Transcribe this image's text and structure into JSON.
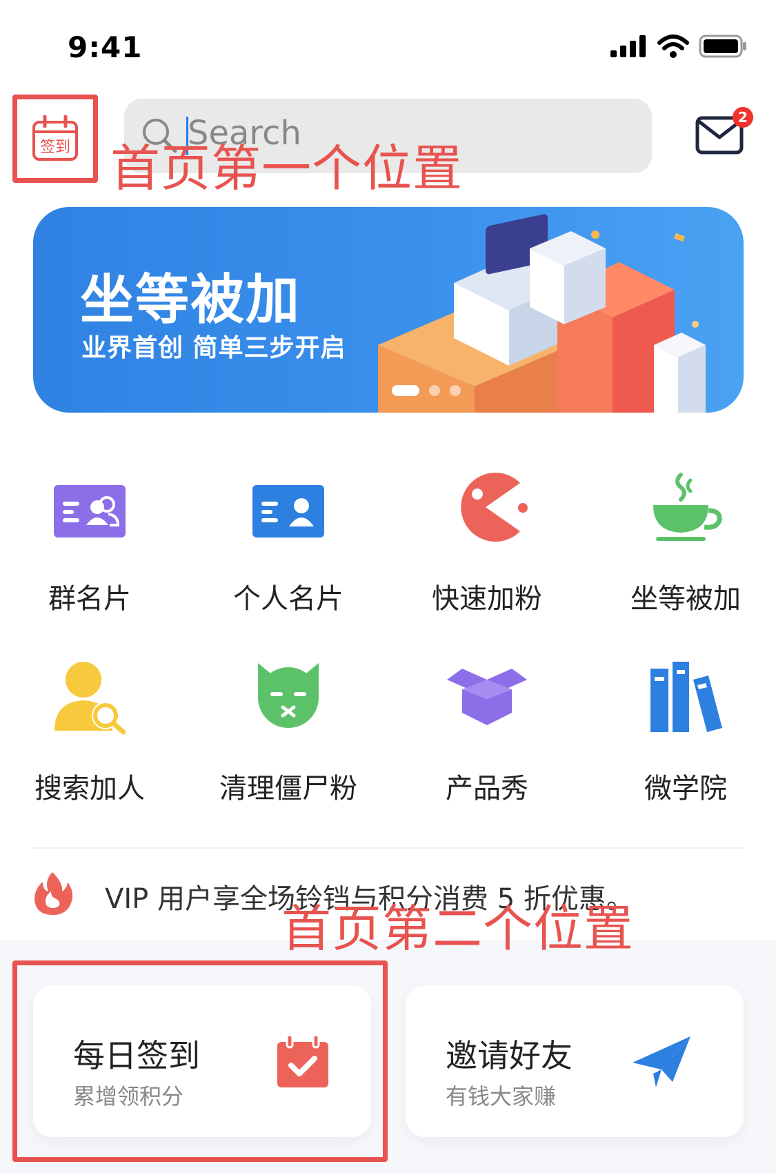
{
  "status_bar": {
    "time": "9:41"
  },
  "header": {
    "sign_in_label": "签到",
    "search_placeholder": "Search",
    "mail_badge_count": "2"
  },
  "annotations": {
    "first_position": "首页第一个位置",
    "second_position": "首页第二个位置"
  },
  "banner": {
    "title": "坐等被加",
    "subtitle": "业界首创  简单三步开启"
  },
  "features": [
    {
      "label": "群名片",
      "icon": "group-card-icon",
      "color": "#8b6ee8"
    },
    {
      "label": "个人名片",
      "icon": "personal-card-icon",
      "color": "#2d7fe0"
    },
    {
      "label": "快速加粉",
      "icon": "pacman-icon",
      "color": "#ec635a"
    },
    {
      "label": "坐等被加",
      "icon": "coffee-cup-icon",
      "color": "#5cc26a"
    },
    {
      "label": "搜索加人",
      "icon": "user-search-icon",
      "color": "#f7c93c"
    },
    {
      "label": "清理僵尸粉",
      "icon": "monster-face-icon",
      "color": "#5cc26a"
    },
    {
      "label": "产品秀",
      "icon": "open-box-icon",
      "color": "#8b6ee8"
    },
    {
      "label": "微学院",
      "icon": "books-icon",
      "color": "#2d7fe0"
    }
  ],
  "notice": {
    "text": "VIP 用户享全场铃铛与积分消费 5 折优惠。",
    "icon": "fire-icon",
    "color": "#ec635a"
  },
  "cards": [
    {
      "title": "每日签到",
      "subtitle": "累增领积分",
      "icon": "calendar-check-icon",
      "color": "#ec635a"
    },
    {
      "title": "邀请好友",
      "subtitle": "有钱大家赚",
      "icon": "paper-plane-icon",
      "color": "#2d7fe0"
    }
  ]
}
